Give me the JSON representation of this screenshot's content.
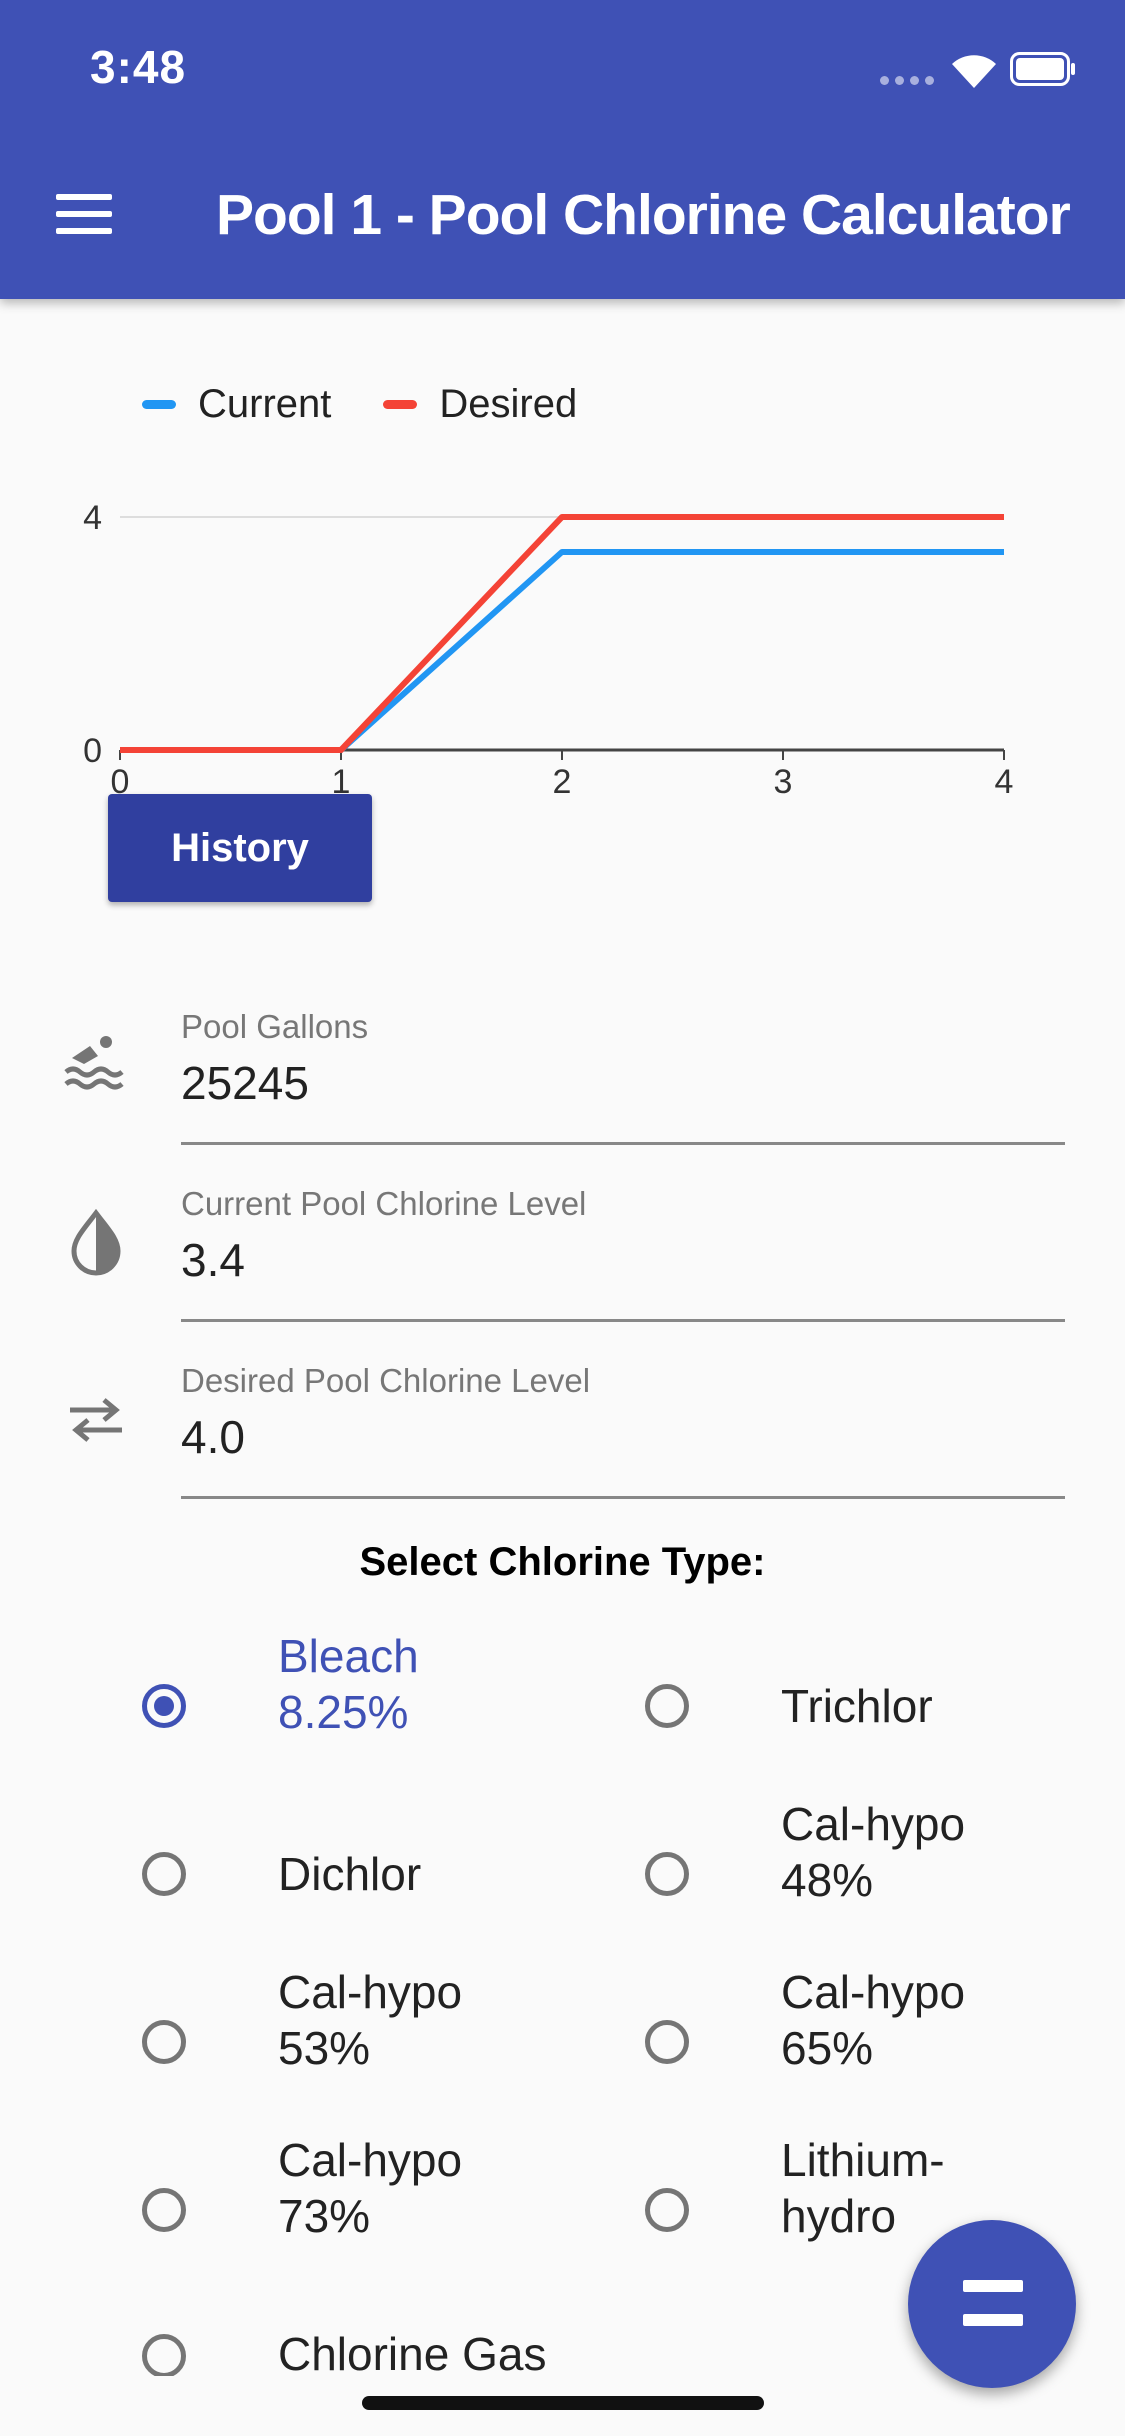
{
  "status_bar": {
    "time": "3:48"
  },
  "app_bar": {
    "title": "Pool 1 - Pool Chlorine Calculator"
  },
  "chart_data": {
    "type": "line",
    "x": [
      0,
      1,
      2,
      3,
      4
    ],
    "series": [
      {
        "name": "Current",
        "values": [
          0,
          0,
          3.4,
          3.4,
          3.4
        ],
        "color": "#2196f3"
      },
      {
        "name": "Desired",
        "values": [
          0,
          0,
          4.0,
          4.0,
          4.0
        ],
        "color": "#f44336"
      }
    ],
    "x_ticks": [
      "0",
      "1",
      "2",
      "3",
      "4"
    ],
    "y_ticks": [
      "0",
      "4"
    ],
    "xlim": [
      0,
      4
    ],
    "ylim": [
      0,
      4
    ],
    "legend_position": "top-left",
    "grid": true
  },
  "history_button": {
    "label": "History"
  },
  "fields": {
    "gallons": {
      "label": "Pool Gallons",
      "value": "25245",
      "icon": "swimmer-icon"
    },
    "current": {
      "label": "Current Pool Chlorine Level",
      "value": "3.4",
      "icon": "water-drop-icon"
    },
    "desired": {
      "label": "Desired Pool Chlorine Level",
      "value": "4.0",
      "icon": "swap-arrows-icon"
    }
  },
  "chlorine_type": {
    "title": "Select Chlorine Type:",
    "selected": "Bleach 8.25%",
    "options": [
      {
        "line1": "Bleach",
        "line2": "8.25%"
      },
      {
        "line1": "Trichlor",
        "line2": ""
      },
      {
        "line1": "Dichlor",
        "line2": ""
      },
      {
        "line1": "Cal-hypo",
        "line2": "48%"
      },
      {
        "line1": "Cal-hypo",
        "line2": "53%"
      },
      {
        "line1": "Cal-hypo",
        "line2": "65%"
      },
      {
        "line1": "Cal-hypo",
        "line2": "73%"
      },
      {
        "line1": "Lithium-",
        "line2": "hydro"
      },
      {
        "line1": "Chlorine Gas",
        "line2": ""
      }
    ]
  },
  "fab": {
    "icon": "equals-icon"
  },
  "colors": {
    "primary": "#3f51b5",
    "primary_dark": "#303f9f",
    "current_series": "#2196f3",
    "desired_series": "#f44336"
  }
}
